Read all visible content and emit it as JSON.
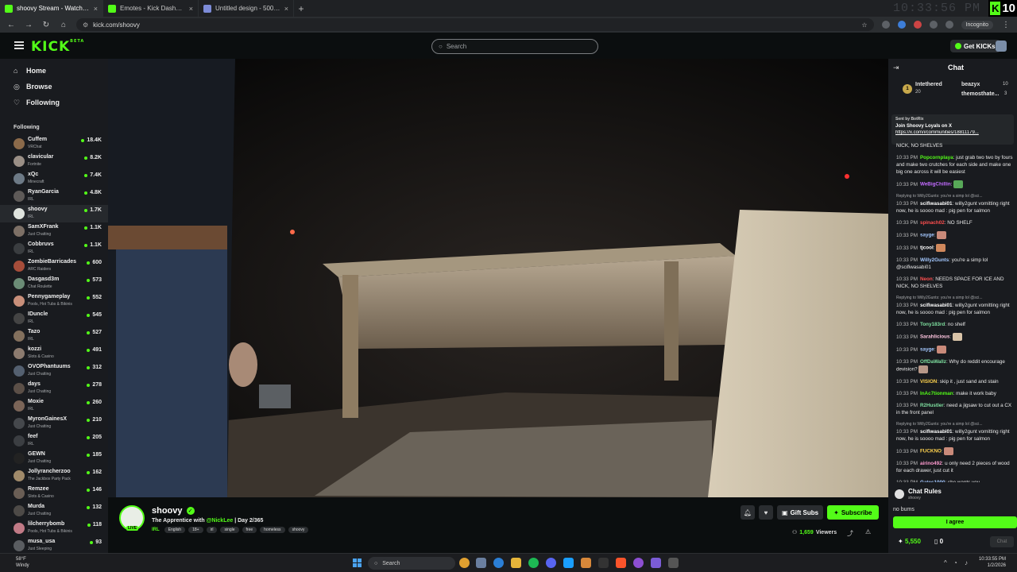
{
  "tabs": [
    {
      "title": "shoovy Stream - Watch Live",
      "color": "#53fc18",
      "active": true
    },
    {
      "title": "Emotes - Kick Dashboard",
      "color": "#53fc18",
      "active": false
    },
    {
      "title": "Untitled design - 500 × 500px",
      "color": "#7d8cd8",
      "active": false
    }
  ],
  "browser": {
    "url": "kick.com/shoovy",
    "incognito": "Incognito",
    "overlay_time": "10:33:56 PM",
    "overlay_count": "10",
    "overlay_k": "K"
  },
  "header": {
    "logo": "KICK",
    "logo_sup": "BETA",
    "search_placeholder": "Search",
    "get_kicks": "Get KICKs"
  },
  "sidebar": {
    "nav": [
      {
        "label": "Home",
        "icon": "home-icon"
      },
      {
        "label": "Browse",
        "icon": "browse-icon"
      },
      {
        "label": "Following",
        "icon": "heart-icon"
      }
    ],
    "following_header": "Following",
    "channels": [
      {
        "name": "Cuffem",
        "category": "VRChat",
        "viewers": "18.4K",
        "color": "#8b6a4a"
      },
      {
        "name": "clavicular",
        "category": "Fortnite",
        "viewers": "8.2K",
        "color": "#9a8f86"
      },
      {
        "name": "xQc",
        "category": "Minecraft",
        "viewers": "7.4K",
        "color": "#6d7a86"
      },
      {
        "name": "RyanGarcia",
        "category": "IRL",
        "viewers": "4.8K",
        "color": "#5e5a58"
      },
      {
        "name": "shoovy",
        "category": "IRL",
        "viewers": "1.7K",
        "color": "#dfe3de",
        "active": true
      },
      {
        "name": "SamXFrank",
        "category": "Just Chatting",
        "viewers": "1.1K",
        "color": "#7d7066"
      },
      {
        "name": "Cobbruvs",
        "category": "IRL",
        "viewers": "1.1K",
        "color": "#3a3d40"
      },
      {
        "name": "ZombieBarricades",
        "category": "ARC Raiders",
        "viewers": "600",
        "color": "#a64d3a"
      },
      {
        "name": "Dasgasd3m",
        "category": "Chat Roulette",
        "viewers": "573",
        "color": "#6b8c76"
      },
      {
        "name": "Pennygameplay",
        "category": "Pools, Hot Tubs & Bikinis",
        "viewers": "552",
        "color": "#c88f7a"
      },
      {
        "name": "IDuncle",
        "category": "IRL",
        "viewers": "545",
        "color": "#444"
      },
      {
        "name": "Tazo",
        "category": "IRL",
        "viewers": "527",
        "color": "#83705d"
      },
      {
        "name": "kozzi",
        "category": "Slots & Casino",
        "viewers": "491",
        "color": "#8c7b6f"
      },
      {
        "name": "OVOPhantuums",
        "category": "Just Chatting",
        "viewers": "312",
        "color": "#546070"
      },
      {
        "name": "days",
        "category": "Just Chatting",
        "viewers": "278",
        "color": "#5b4f47"
      },
      {
        "name": "Moxie",
        "category": "IRL",
        "viewers": "260",
        "color": "#7b6558"
      },
      {
        "name": "MyronGainesX",
        "category": "Just Chatting",
        "viewers": "210",
        "color": "#45484c"
      },
      {
        "name": "feef",
        "category": "IRL",
        "viewers": "205",
        "color": "#3b3e42"
      },
      {
        "name": "GEWN",
        "category": "Just Chatting",
        "viewers": "185",
        "color": "#222"
      },
      {
        "name": "Jollyrancherzoo",
        "category": "The Jackbox Party Pack",
        "viewers": "162",
        "color": "#a08a6a"
      },
      {
        "name": "Remzee",
        "category": "Slots & Casino",
        "viewers": "146",
        "color": "#6a5e55"
      },
      {
        "name": "Murda",
        "category": "Just Chatting",
        "viewers": "132",
        "color": "#4d4a47"
      },
      {
        "name": "lilcherrybomb",
        "category": "Pools, Hot Tubs & Bikinis",
        "viewers": "118",
        "color": "#c17a86"
      },
      {
        "name": "musa_usa",
        "category": "Just Sleeping",
        "viewers": "93",
        "color": "#5a5d61"
      }
    ]
  },
  "stream": {
    "name": "shoovy",
    "live": "LIVE",
    "title_prefix": "The Apprentice with ",
    "title_mention": "@NickLee",
    "title_suffix": " | Day 2/365",
    "category": "IRL",
    "tags": [
      "English",
      "18+",
      "irl",
      "single",
      "free",
      "homeless",
      "shoovy"
    ],
    "gift_subs": "Gift Subs",
    "subscribe": "Subscribe",
    "viewers": "1,659",
    "viewers_label": "Viewers"
  },
  "chat": {
    "title": "Chat",
    "leaderboard": [
      {
        "name": "Intethered",
        "count": "20",
        "color": "#c7a84b"
      },
      {
        "name": "beazyx",
        "count": "10",
        "color": "#ffffff"
      },
      {
        "name": "themosthate...",
        "count": "3",
        "color": "#c7a84b"
      }
    ],
    "medal": "1",
    "pinned": {
      "header": "Sent by BotRix",
      "text": "Join Shoovy Loyals on X",
      "link": "https://x.com/i/communities/18811179..."
    },
    "messages": [
      {
        "ts": "",
        "user": "",
        "text": "NICK, NO SHELVES",
        "color": "#fff"
      },
      {
        "ts": "10:33 PM",
        "user": "Popcornplaya",
        "text": ": just grab two two by fours and make two crutches for each side and make one big one across it will be easiest",
        "color": "#53fc18"
      },
      {
        "ts": "10:33 PM",
        "user": "WeBigChillin",
        "text": ":",
        "color": "#c26bff",
        "emote": "#58a858"
      },
      {
        "ts": "10:33 PM",
        "user": "scifiwasabi01",
        "text": ": willy2gunt vomitting right now, he is soooo mad : pig pen for salmon",
        "color": "#fff",
        "reply": "Replying to Willy2Gunts: you're a simp lol @sci..."
      },
      {
        "ts": "10:33 PM",
        "user": "spinach02",
        "text": ": NO SHELF",
        "color": "#ff4f4f"
      },
      {
        "ts": "10:33 PM",
        "user": "sayge",
        "text": ":",
        "color": "#a4c8ff",
        "emote": "#c98a7a"
      },
      {
        "ts": "10:33 PM",
        "user": "tjcool",
        "text": ":",
        "color": "#fff",
        "emote": "#d0885c"
      },
      {
        "ts": "10:33 PM",
        "user": "Willy2Gunts",
        "text": ": you're a simp lol @scifiwasabi01",
        "color": "#a4c8ff"
      },
      {
        "ts": "10:33 PM",
        "user": "Neon",
        "text": ": NEEDS SPACE FOR ICE AND NICK, NO SHELVES",
        "color": "#ff4f4f"
      },
      {
        "ts": "10:33 PM",
        "user": "scifiwasabi01",
        "text": ": willy2gunt vomitting right now, he is soooo mad : pig pen for salmon",
        "color": "#fff",
        "reply": "Replying to Willy2Gunts: you're a simp lol @sci..."
      },
      {
        "ts": "10:33 PM",
        "user": "Tony183rd",
        "text": ": no shelf",
        "color": "#7fe0a0"
      },
      {
        "ts": "10:33 PM",
        "user": "Sarahlicious",
        "text": ":",
        "color": "#ffc6e0",
        "emote": "#d9c4a8"
      },
      {
        "ts": "10:33 PM",
        "user": "sayge",
        "text": ":",
        "color": "#a4c8ff",
        "emote": "#c98a7a"
      },
      {
        "ts": "10:33 PM",
        "user": "OffDaWallz",
        "text": ": Why do reddit encourage devision?",
        "color": "#7fe0a0",
        "emote": "#b89888"
      },
      {
        "ts": "10:33 PM",
        "user": "VISION",
        "text": ": skip it , just sand and stain",
        "color": "#ffd34f"
      },
      {
        "ts": "10:33 PM",
        "user": "InAc7tionman",
        "text": ": make it work baby",
        "color": "#53fc18"
      },
      {
        "ts": "10:33 PM",
        "user": "R2Hustler",
        "text": ": need a jigsaw to cut out a CX in the front panel",
        "color": "#7fe0a0"
      },
      {
        "ts": "10:33 PM",
        "user": "scifiwasabi01",
        "text": ": willy2gunt vomitting right now, he is soooo mad : pig pen for salmon",
        "color": "#fff",
        "reply": "Replying to Willy2Gunts: you're a simp lol @sci..."
      },
      {
        "ts": "10:33 PM",
        "user": "FUCKNO",
        "text": ":",
        "color": "#ffd34f",
        "emote": "#c98a7a"
      },
      {
        "ts": "10:33 PM",
        "user": "airino492",
        "text": ": u only need 2 pieces of wood for each drawer, just cut it",
        "color": "#ff9bd0"
      },
      {
        "ts": "10:33 PM",
        "user": "Gates1000",
        "text": ": she wants you",
        "color": "#a4c8ff"
      }
    ],
    "rules_title": "Chat Rules",
    "rules_sub": "shoovy",
    "rules_body": "no bums",
    "agree": "I agree",
    "kicks": "5,550",
    "zero": "0",
    "chat_button": "Chat"
  },
  "taskbar": {
    "temp": "58°F",
    "weather": "Windy",
    "search": "Search",
    "time": "10:33:55 PM",
    "date": "1/2/2026"
  }
}
